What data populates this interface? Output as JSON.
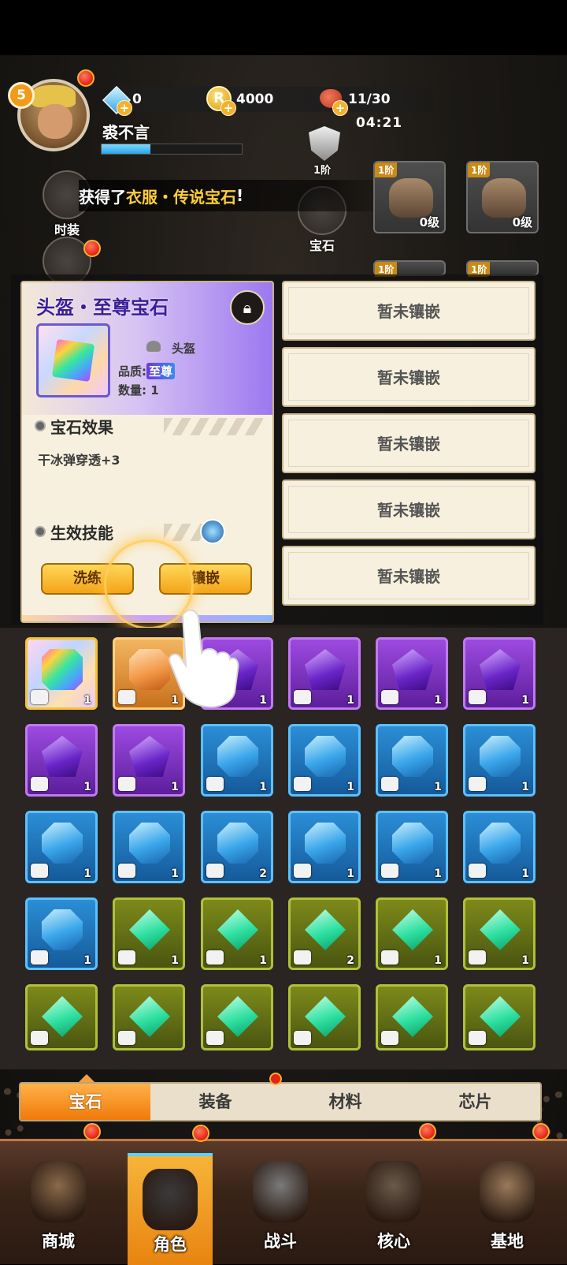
{
  "player": {
    "level": "5",
    "name": "裘不言",
    "exp_fraction": 0.35
  },
  "resources": {
    "gems": "0",
    "coins": "4000",
    "stamina": "11/30",
    "timer": "04:21",
    "coin_symbol": "R"
  },
  "rank": {
    "label": "1阶"
  },
  "side_buttons": {
    "costume": "时装",
    "gem": "宝石"
  },
  "notice": {
    "prefix": "获得了",
    "highlight": "衣服・传说宝石",
    "suffix": "!"
  },
  "equipment_slots": [
    {
      "tier": "1阶",
      "level": "0级",
      "icon": "helmet-icon"
    },
    {
      "tier": "1阶",
      "level": "0级",
      "icon": "gauntlet-icon"
    },
    {
      "tier": "1阶",
      "level": "",
      "icon": "armor-icon"
    },
    {
      "tier": "1阶",
      "level": "",
      "icon": "glove-icon"
    }
  ],
  "gem_detail": {
    "title": "头盔・至尊宝石",
    "slot": "头盔",
    "quality_label": "品质:",
    "quality_value": "至尊",
    "quantity_label": "数量:",
    "quantity_value": "1",
    "effect_heading": "宝石效果",
    "effect_text": "干冰弹穿透+3",
    "skill_heading": "生效技能",
    "refine_button": "洗练",
    "inlay_button": "镶嵌"
  },
  "sockets": [
    {
      "label": "暂未镶嵌"
    },
    {
      "label": "暂未镶嵌"
    },
    {
      "label": "暂未镶嵌"
    },
    {
      "label": "暂未镶嵌"
    },
    {
      "label": "暂未镶嵌"
    }
  ],
  "inventory": [
    {
      "rarity": "rainbow",
      "gem": "prism",
      "slot": "helmet",
      "qty": "1"
    },
    {
      "rarity": "orange",
      "gem": "cube",
      "slot": "pants",
      "qty": "1"
    },
    {
      "rarity": "purple",
      "gem": "pent",
      "slot": "helmet",
      "qty": "1"
    },
    {
      "rarity": "purple",
      "gem": "pent",
      "slot": "armor",
      "qty": "1"
    },
    {
      "rarity": "purple",
      "gem": "pent",
      "slot": "boots",
      "qty": "1"
    },
    {
      "rarity": "purple",
      "gem": "pent",
      "slot": "gauntlet",
      "qty": "1"
    },
    {
      "rarity": "purple",
      "gem": "pent",
      "slot": "pants",
      "qty": "1"
    },
    {
      "rarity": "purple",
      "gem": "pent",
      "slot": "pants",
      "qty": "1"
    },
    {
      "rarity": "blue",
      "gem": "oct",
      "slot": "helmet",
      "qty": "1"
    },
    {
      "rarity": "blue",
      "gem": "oct",
      "slot": "armor",
      "qty": "1"
    },
    {
      "rarity": "blue",
      "gem": "oct",
      "slot": "boots",
      "qty": "1"
    },
    {
      "rarity": "blue",
      "gem": "oct",
      "slot": "boots",
      "qty": "1"
    },
    {
      "rarity": "blue",
      "gem": "oct",
      "slot": "gauntlet",
      "qty": "1"
    },
    {
      "rarity": "blue",
      "gem": "oct",
      "slot": "gauntlet",
      "qty": "1"
    },
    {
      "rarity": "blue",
      "gem": "oct",
      "slot": "pants",
      "qty": "2"
    },
    {
      "rarity": "blue",
      "gem": "oct",
      "slot": "pants",
      "qty": "1"
    },
    {
      "rarity": "blue",
      "gem": "oct",
      "slot": "pants",
      "qty": "1"
    },
    {
      "rarity": "blue",
      "gem": "oct",
      "slot": "glove",
      "qty": "1"
    },
    {
      "rarity": "blue",
      "gem": "oct",
      "slot": "glove",
      "qty": "1"
    },
    {
      "rarity": "green",
      "gem": "diamond",
      "slot": "helmet",
      "qty": "1"
    },
    {
      "rarity": "green",
      "gem": "diamond",
      "slot": "helmet",
      "qty": "1"
    },
    {
      "rarity": "green",
      "gem": "diamond",
      "slot": "helmet",
      "qty": "2"
    },
    {
      "rarity": "green",
      "gem": "diamond",
      "slot": "armor",
      "qty": "1"
    },
    {
      "rarity": "green",
      "gem": "diamond",
      "slot": "armor",
      "qty": "1"
    },
    {
      "rarity": "green",
      "gem": "diamond",
      "slot": "armor",
      "qty": ""
    },
    {
      "rarity": "green",
      "gem": "diamond",
      "slot": "armor",
      "qty": ""
    },
    {
      "rarity": "green",
      "gem": "diamond",
      "slot": "armor",
      "qty": ""
    },
    {
      "rarity": "green",
      "gem": "diamond",
      "slot": "armor",
      "qty": ""
    },
    {
      "rarity": "green",
      "gem": "diamond",
      "slot": "boots",
      "qty": ""
    },
    {
      "rarity": "green",
      "gem": "diamond",
      "slot": "boots",
      "qty": ""
    }
  ],
  "tabs": [
    {
      "label": "宝石",
      "active": true
    },
    {
      "label": "装备",
      "active": false
    },
    {
      "label": "材料",
      "active": false
    },
    {
      "label": "芯片",
      "active": false
    }
  ],
  "nav": [
    {
      "label": "商城",
      "icon": "shop-icon",
      "active": false,
      "badge": true
    },
    {
      "label": "角色",
      "icon": "character-icon",
      "active": true,
      "badge": true
    },
    {
      "label": "战斗",
      "icon": "battle-icon",
      "active": false,
      "badge": false
    },
    {
      "label": "核心",
      "icon": "core-icon",
      "active": false,
      "badge": true
    },
    {
      "label": "基地",
      "icon": "base-icon",
      "active": false,
      "badge": true
    }
  ]
}
